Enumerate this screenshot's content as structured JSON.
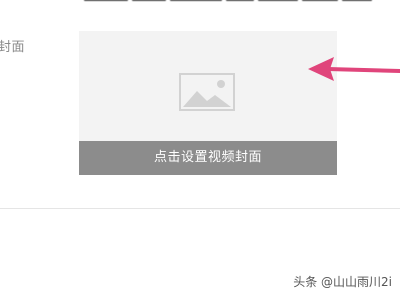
{
  "field": {
    "label": "封面"
  },
  "cover": {
    "set_cover_label": "点击设置视频封面",
    "placeholder_icon": "image-icon"
  },
  "annotation": {
    "arrow_color": "#e0457b"
  },
  "watermark": {
    "text": "头条 @山山雨川2i"
  },
  "colors": {
    "cover_box_bg": "#f3f3f3",
    "cover_bar_bg": "#8c8c8c",
    "label_text": "#8a8a8a"
  }
}
